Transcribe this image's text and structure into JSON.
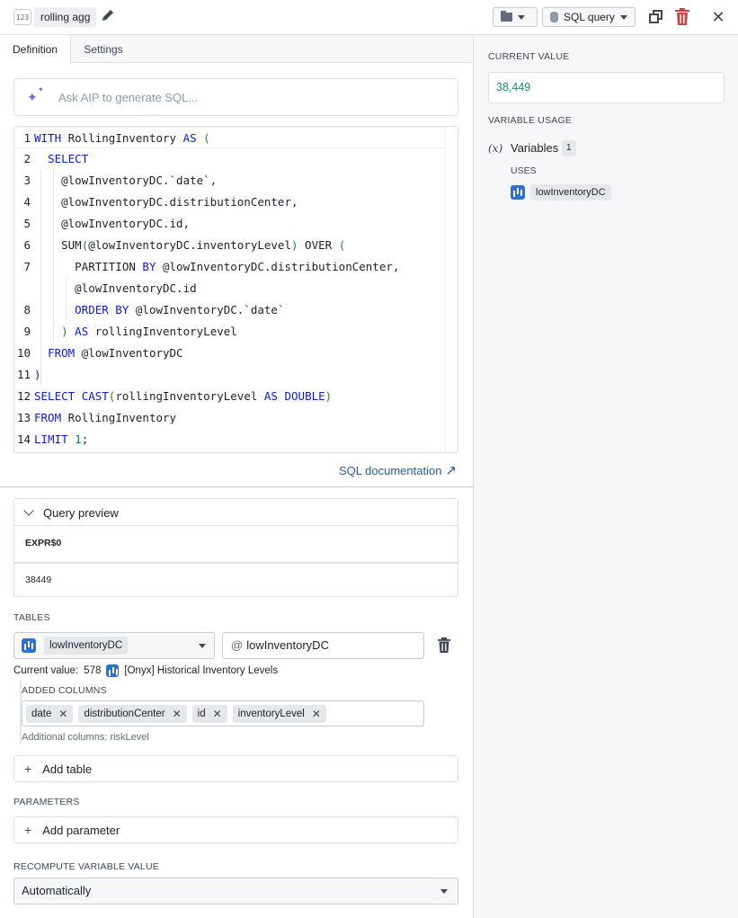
{
  "header": {
    "type_icon": "123",
    "variable_name": "rolling agg",
    "query_type": "SQL query"
  },
  "tabs": [
    {
      "label": "Definition",
      "active": true
    },
    {
      "label": "Settings",
      "active": false
    }
  ],
  "aip": {
    "placeholder": "Ask AIP to generate SQL..."
  },
  "code": {
    "line_numbers": [
      "1",
      "2",
      "3",
      "4",
      "5",
      "6",
      "7",
      "",
      "8",
      "9",
      "10",
      "11",
      "12",
      "13",
      "14"
    ]
  },
  "sql_doc_link": "SQL documentation",
  "query_preview": {
    "title": "Query preview",
    "column": "EXPR$0",
    "value": "38449"
  },
  "tables": {
    "label": "TABLES",
    "selected_table": "lowInventoryDC",
    "alias": "lowInventoryDC",
    "alias_prefix": "@",
    "current_value_label": "Current value:",
    "current_value_count": "578",
    "current_value_source": "[Onyx] Historical Inventory Levels",
    "added_columns_label": "ADDED COLUMNS",
    "columns": [
      "date",
      "distributionCenter",
      "id",
      "inventoryLevel"
    ],
    "additional_columns": "Additional columns: riskLevel",
    "add_table": "Add table"
  },
  "parameters": {
    "label": "PARAMETERS",
    "add_parameter": "Add parameter"
  },
  "recompute": {
    "label": "RECOMPUTE VARIABLE VALUE",
    "value": "Automatically"
  },
  "right": {
    "current_value_label": "CURRENT VALUE",
    "current_value": "38,449",
    "usage_label": "VARIABLE USAGE",
    "fx": "(x)",
    "variables_label": "Variables",
    "variables_count": "1",
    "uses_label": "USES",
    "uses_item": "lowInventoryDC"
  },
  "colors": {
    "accent_blue": "#2d72d2",
    "link": "#215db0",
    "danger": "#cd4246",
    "success_value": "#1f8a70",
    "aip_purple": "#7961db"
  }
}
